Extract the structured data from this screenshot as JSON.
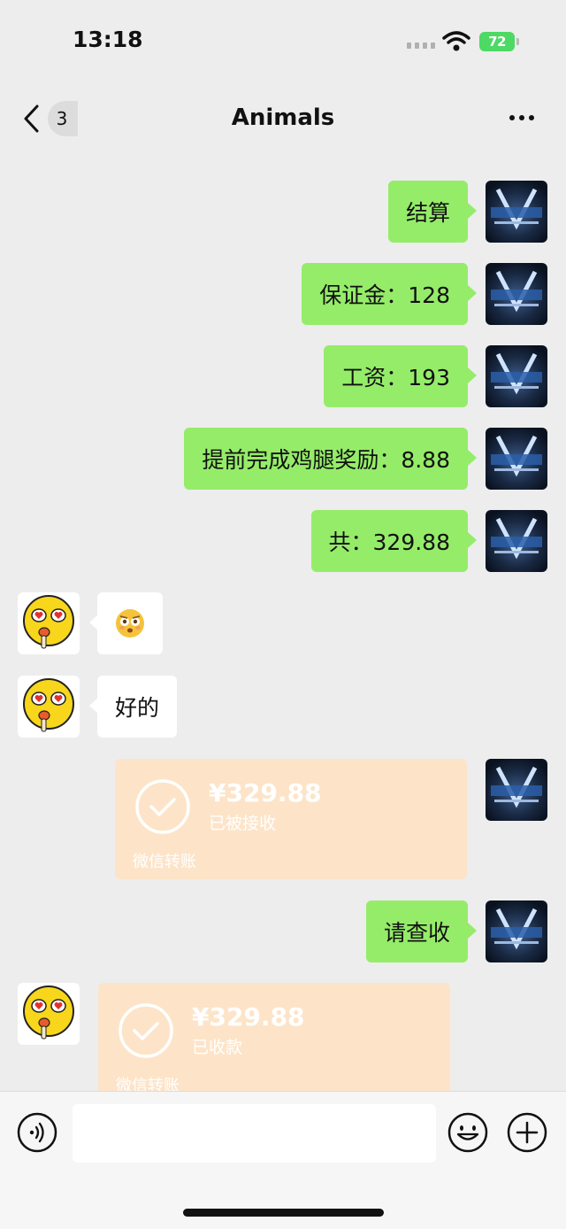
{
  "status_bar": {
    "time": "13:18",
    "battery": "72"
  },
  "nav": {
    "back_badge": "3",
    "title": "Animals"
  },
  "messages": [
    {
      "text": "结算"
    },
    {
      "text": "保证金：128"
    },
    {
      "text": "工资：193"
    },
    {
      "text": "提前完成鸡腿奖励：8.88"
    },
    {
      "text": "共：329.88"
    },
    {
      "text": "好的"
    },
    {
      "text": "请查收"
    }
  ],
  "transfers": [
    {
      "amount": "¥329.88",
      "state": "已被接收",
      "label": "微信转账"
    },
    {
      "amount": "¥329.88",
      "state": "已收款",
      "label": "微信转账"
    }
  ],
  "colors": {
    "outgoing_bubble": "#95ec69",
    "transfer_card": "#fde4c8",
    "battery": "#4cd964"
  }
}
